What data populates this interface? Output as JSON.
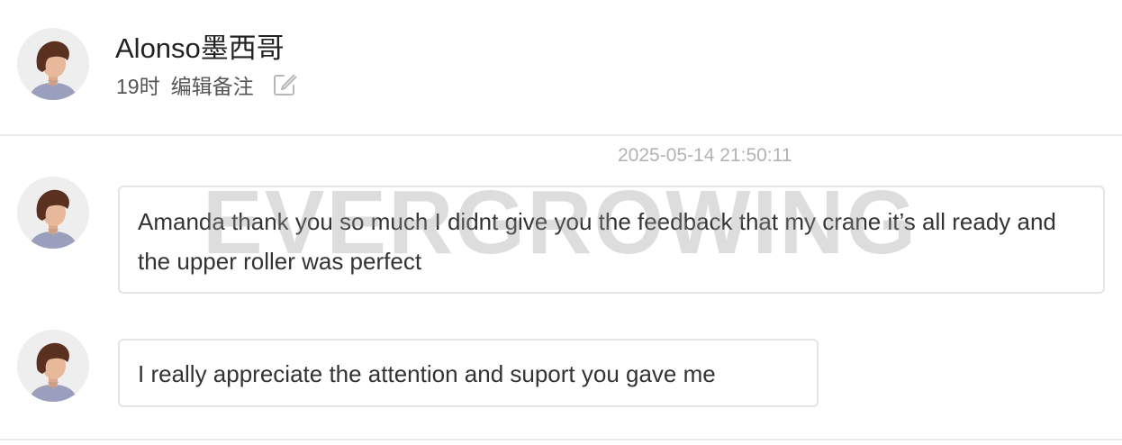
{
  "contact": {
    "name": "Alonso墨西哥",
    "time": "19时",
    "remark_label": "编辑备注",
    "avatar_icon": "person-avatar-icon",
    "edit_icon": "edit-note-icon"
  },
  "conversation": {
    "timestamp": "2025-05-14 21:50:11",
    "messages": [
      {
        "text": "Amanda thank you so much I didnt give you the feedback that my crane it’s all ready and the upper roller was perfect"
      },
      {
        "text": "I really appreciate the attention and suport you gave me"
      }
    ]
  },
  "watermark": "EVERGROWING",
  "colors": {
    "divider": "#ebebeb",
    "bubble_border": "#e5e5e5",
    "timestamp": "#b3b3b3",
    "avatar_bg": "#eeeeee",
    "hair": "#5a3120",
    "skin": "#e8b89b",
    "shirt": "#9b9fbe"
  }
}
